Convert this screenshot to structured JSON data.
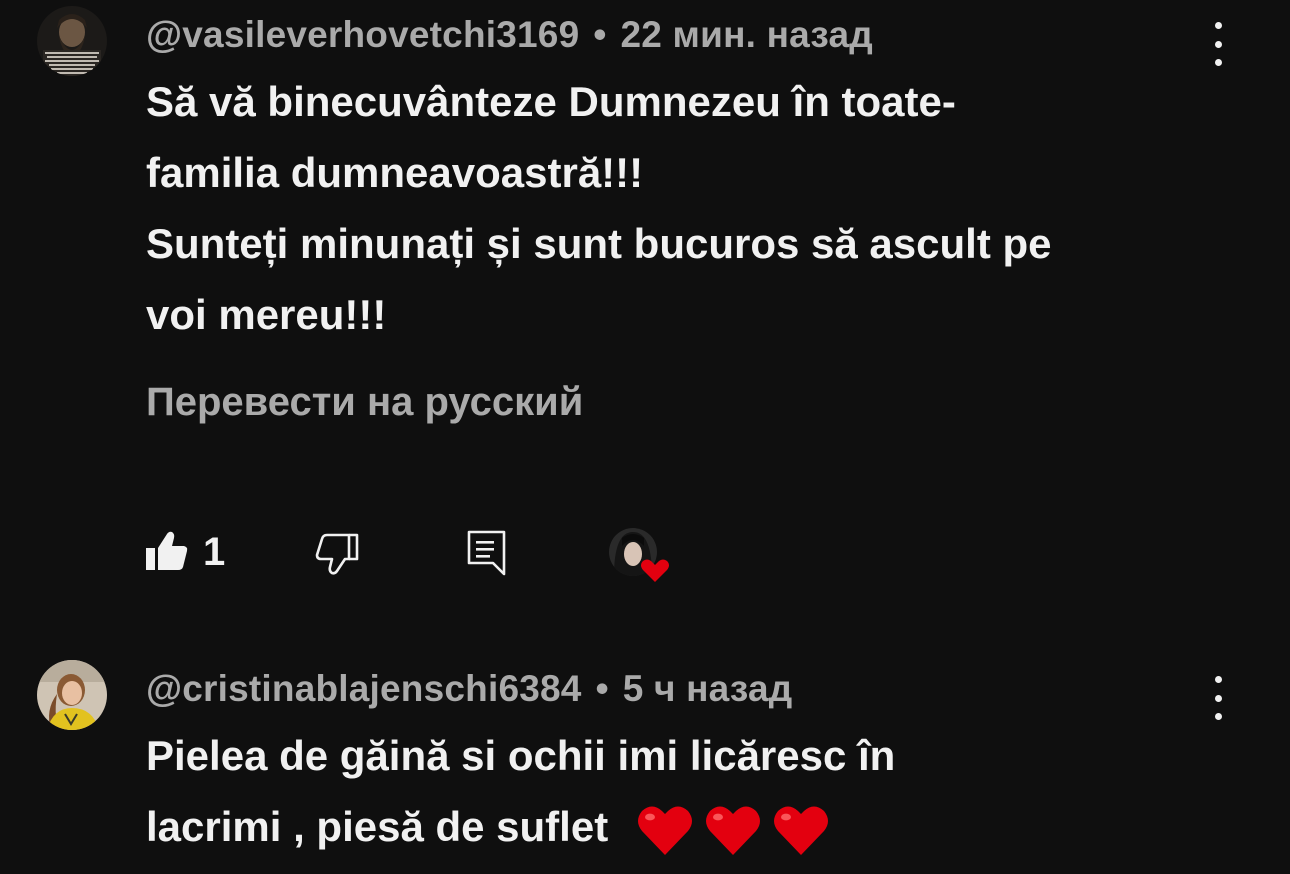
{
  "comments": [
    {
      "author": "@vasileverhovetchi3169",
      "separator": "•",
      "time": "22 мин. назад",
      "lines": [
        "Să vă binecuvânteze Dumnezeu în toate-",
        "familia dumneavoastră!!!",
        "Sunteți minunați și sunt bucuros să ascult pe",
        "voi mereu!!!"
      ],
      "translate_label": "Перевести на русский",
      "like_count": "1",
      "icons": {
        "avatar": "avatar-bearded-man",
        "like": "thumbs-up-filled-icon",
        "dislike": "thumbs-down-outline-icon",
        "reply": "reply-comment-icon",
        "creator_heart": "creator-heart-icon",
        "more": "more-vertical-icon"
      }
    },
    {
      "author": "@cristinablajenschi6384",
      "separator": "•",
      "time": "5 ч назад",
      "lines": [
        "Pielea de găină  si ochii imi licăresc  în",
        "lacrimi  , piesă de suflet"
      ],
      "emoji": "❤️❤️❤️",
      "icons": {
        "avatar": "avatar-woman-smiling",
        "more": "more-vertical-icon"
      }
    }
  ],
  "colors": {
    "background": "#0f0f0f",
    "text": "#f1f1f1",
    "secondary_text": "#aaaaaa",
    "heart": "#e3000f"
  }
}
